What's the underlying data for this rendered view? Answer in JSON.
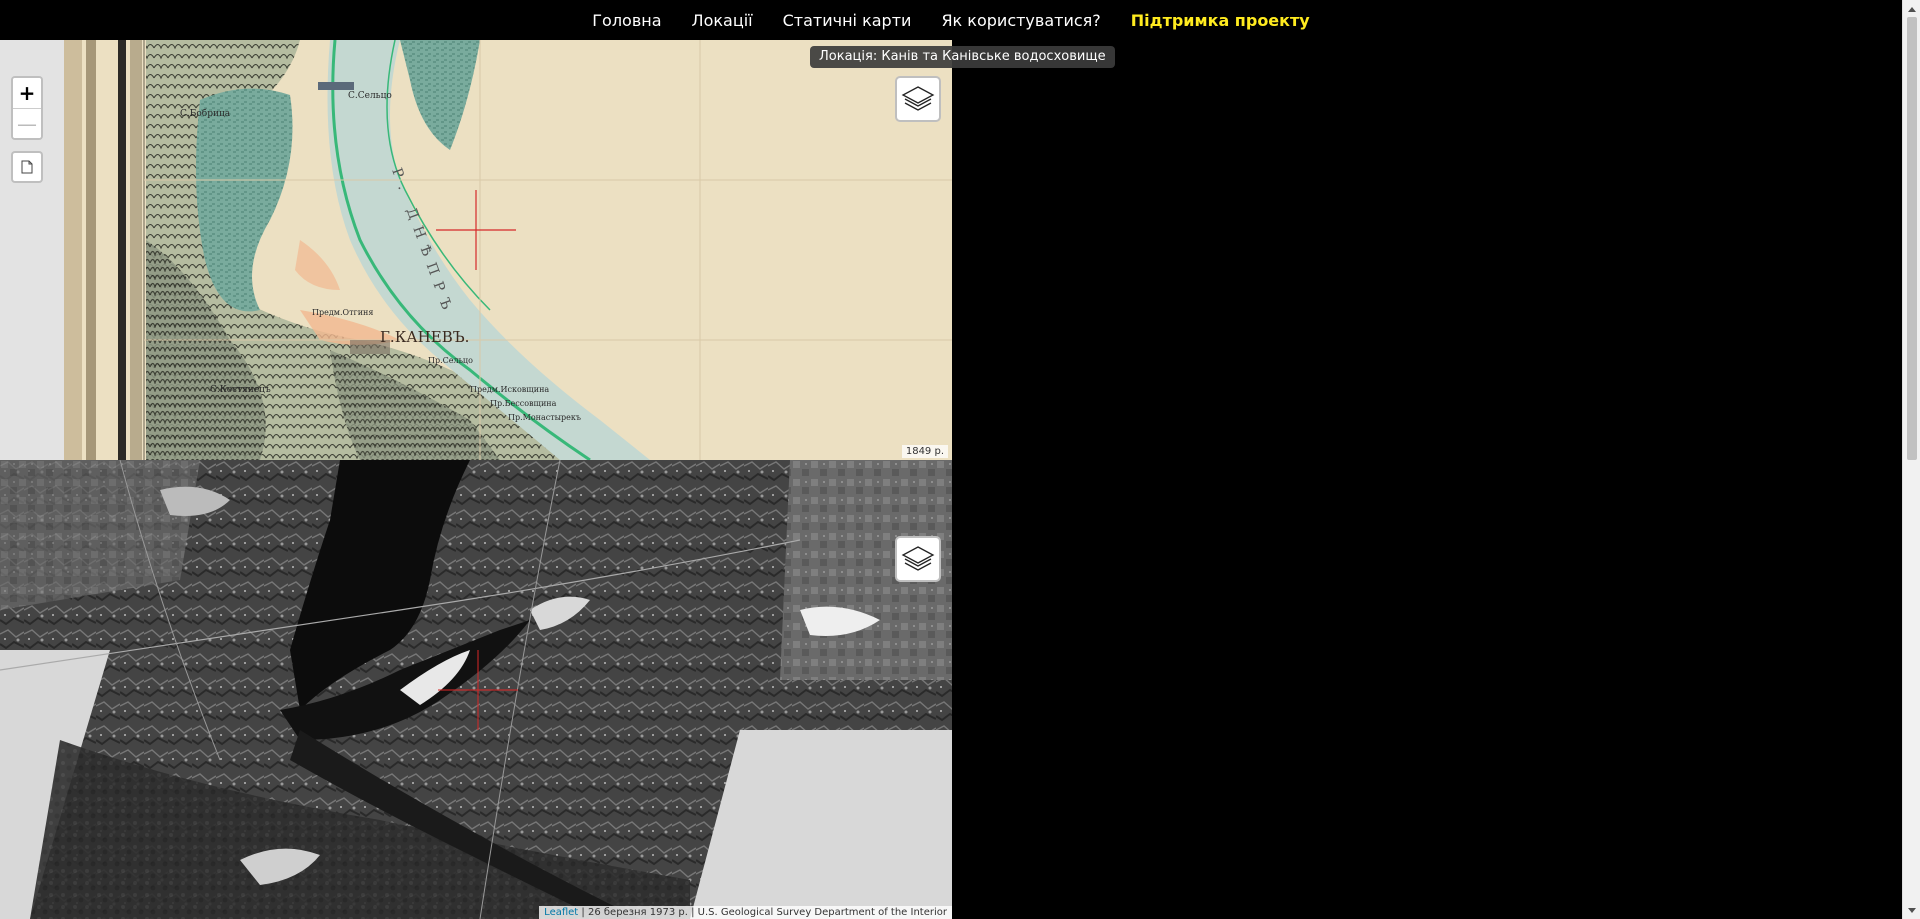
{
  "nav": {
    "items": [
      {
        "label": "Головна"
      },
      {
        "label": "Локації"
      },
      {
        "label": "Статичні карти"
      },
      {
        "label": "Як користуватися?"
      },
      {
        "label": "Підтримка проекту",
        "highlight": true
      }
    ]
  },
  "location_badge": "Локація: Канів та Канівське водосховище",
  "map_top": {
    "zoom_in_label": "+",
    "zoom_out_label": "—",
    "date_label": "1849 р.",
    "map_labels": {
      "town": "Г.КАНЕВЪ.",
      "village_1": "С.Бобрица",
      "village_2": "С.Сельцо",
      "village_3": "С.Костянецъ",
      "suburb_1": "Предм.Отгиня",
      "suburb_2": "Пр.Сельцо",
      "suburb_3": "Предм.Исковщина",
      "suburb_4": "Пр.Бессовщина",
      "suburb_5": "Пр.Монастырекъ",
      "river": "Р. ДНѢПРЪ"
    }
  },
  "map_bottom": {
    "attribution": {
      "leaflet": "Leaflet",
      "rest": "| 26 березня 1973 р. | U.S. Geological Survey Department of the Interior"
    }
  },
  "colors": {
    "nav_bg": "#000000",
    "nav_text": "#ffffff",
    "nav_highlight": "#ffeb1f",
    "crosshair": "#d62828",
    "paper": "#ece0c2",
    "river_fill": "#bfd6d0",
    "river_line": "#38b879",
    "lake": "#6fa89a"
  },
  "icons": {
    "layers": "layers-icon",
    "document": "document-icon"
  }
}
